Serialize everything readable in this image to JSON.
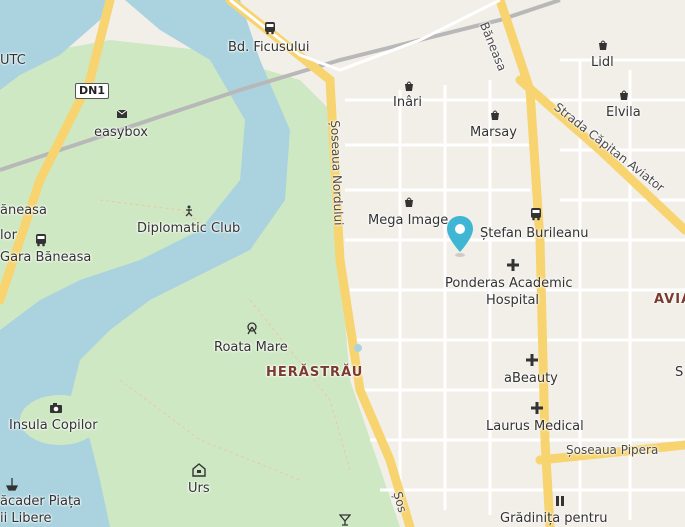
{
  "map": {
    "labels": {
      "utc": "UTC",
      "dn1": "DN1",
      "easybox": "easybox",
      "baneasa_partial": "ăneasa",
      "zlor_partial": "lor",
      "gara_baneasa": "Gara Băneasa",
      "diplomatic_club": "Diplomatic Club",
      "bd_ficusului": "Bd. Ficusului",
      "inari": "Inâri",
      "marsay": "Marsay",
      "lidl": "Lidl",
      "elvila": "Elvila",
      "baneasa_road": "Băneasa",
      "strada_capitan_aviator": "Strada Căpitan Aviator",
      "soseaua_nordului": "Șoseaua Nordului",
      "mega_image": "Mega Image",
      "stefan_burileanu": "Ștefan Burileanu",
      "ponderas": "Ponderas Academic",
      "hospital": "Hospital",
      "avia_partial": "AVIA",
      "roata_mare": "Roata Mare",
      "herastrau": "HERĂSTRĂU",
      "abeauty": "aBeauty",
      "insula_copiilor": "Insula Copilor",
      "laurus_medical": "Laurus Medical",
      "soseaua_pipera": "Șoseaua Pipera",
      "urs": "Urs",
      "debarcader_line1": "ăcader Piața",
      "debarcader_line2": "ii Libere",
      "gradinita": "Grădinița pentru",
      "soseaua_partial": "Șos",
      "s_partial": "S"
    },
    "colors": {
      "water": "#aad3df",
      "park": "#cfe8c4",
      "land": "#f2efe9",
      "major_road": "#f7d470",
      "pin": "#3fb6d3"
    },
    "icons": {
      "bus": "bus-stop-icon",
      "shop": "shopping-bag-icon",
      "hospital": "cross-icon",
      "camera": "camera-icon",
      "monument": "monument-icon",
      "pin": "location-pin-icon"
    }
  }
}
